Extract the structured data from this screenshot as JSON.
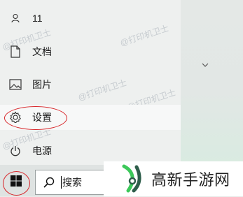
{
  "user": {
    "label": "11"
  },
  "menu": {
    "documents": "文档",
    "pictures": "图片",
    "settings": "设置",
    "power": "电源"
  },
  "watermark": "@打印机卫士",
  "search": {
    "value": "搜索"
  },
  "logo": {
    "text": "高新手游网"
  },
  "colors": {
    "highlight": "#d8262a",
    "logo_green": "#3cc85a",
    "logo_dark": "#2d5d4a"
  }
}
